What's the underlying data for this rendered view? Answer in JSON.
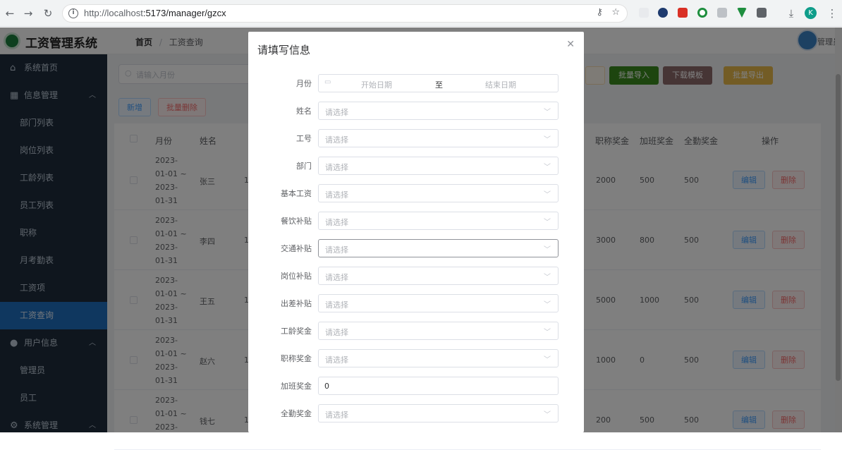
{
  "browser": {
    "url_host": "http://localhost",
    "url_path": ":5173/manager/gzcx",
    "profile_initial": "K"
  },
  "app": {
    "title": "工资管理系统"
  },
  "header": {
    "breadcrumb_home": "首页",
    "breadcrumb_sep": "/",
    "breadcrumb_current": "工资查询",
    "user_label": "管理员"
  },
  "sidebar": {
    "items": [
      {
        "label": "系统首页"
      },
      {
        "label": "信息管理"
      },
      {
        "label": "部门列表"
      },
      {
        "label": "岗位列表"
      },
      {
        "label": "工龄列表"
      },
      {
        "label": "员工列表"
      },
      {
        "label": "职称"
      },
      {
        "label": "月考勤表"
      },
      {
        "label": "工资项"
      },
      {
        "label": "工资查询"
      },
      {
        "label": "用户信息"
      },
      {
        "label": "管理员"
      },
      {
        "label": "员工"
      },
      {
        "label": "系统管理"
      }
    ]
  },
  "toolbar": {
    "search_placeholder": "请输入月份",
    "add_label": "新增",
    "batch_delete_label": "批量删除",
    "import_label": "批量导入",
    "template_label": "下载模板",
    "export_label": "批量导出"
  },
  "table": {
    "headers": {
      "month": "月份",
      "name": "姓名",
      "title_bonus": "职称奖金",
      "overtime_bonus": "加班奖金",
      "attendance_bonus": "全勤奖金",
      "ops": "操作"
    },
    "rows": [
      {
        "m1": "2023-",
        "m2": "01-01 ~",
        "m3": "2023-",
        "m4": "01-31",
        "name": "张三",
        "c1": "1",
        "title": "2000",
        "ot": "500",
        "att": "500"
      },
      {
        "m1": "2023-",
        "m2": "01-01 ~",
        "m3": "2023-",
        "m4": "01-31",
        "name": "李四",
        "c1": "1",
        "title": "3000",
        "ot": "800",
        "att": "500"
      },
      {
        "m1": "2023-",
        "m2": "01-01 ~",
        "m3": "2023-",
        "m4": "01-31",
        "name": "王五",
        "c1": "1",
        "title": "5000",
        "ot": "1000",
        "att": "500"
      },
      {
        "m1": "2023-",
        "m2": "01-01 ~",
        "m3": "2023-",
        "m4": "01-31",
        "name": "赵六",
        "c1": "1",
        "title": "1000",
        "ot": "0",
        "att": "500"
      },
      {
        "m1": "2023-",
        "m2": "01-01 ~",
        "m3": "2023-",
        "m4": "",
        "name": "钱七",
        "c1": "1",
        "title": "200",
        "ot": "500",
        "att": "500"
      }
    ],
    "edit_label": "编辑",
    "delete_label": "删除"
  },
  "dialog": {
    "title": "请填写信息",
    "close_icon": "close-icon",
    "fields": [
      {
        "label": "月份",
        "start_placeholder": "开始日期",
        "sep": "至",
        "end_placeholder": "结束日期"
      },
      {
        "label": "姓名",
        "placeholder": "请选择"
      },
      {
        "label": "工号",
        "placeholder": "请选择"
      },
      {
        "label": "部门",
        "placeholder": "请选择"
      },
      {
        "label": "基本工资",
        "placeholder": "请选择"
      },
      {
        "label": "餐饮补贴",
        "placeholder": "请选择"
      },
      {
        "label": "交通补贴",
        "placeholder": "请选择"
      },
      {
        "label": "岗位补贴",
        "placeholder": "请选择"
      },
      {
        "label": "出差补贴",
        "placeholder": "请选择"
      },
      {
        "label": "工龄奖金",
        "placeholder": "请选择"
      },
      {
        "label": "职称奖金",
        "placeholder": "请选择"
      },
      {
        "label": "加班奖金",
        "value": "0"
      },
      {
        "label": "全勤奖金",
        "placeholder": "请选择"
      }
    ]
  },
  "colors": {
    "sidebar_bg": "#1f2d3d",
    "active_menu": "#1f6fbf",
    "import_btn": "#3a8a1f",
    "template_btn": "#8c6b6b",
    "export_btn": "#e6b94a"
  }
}
